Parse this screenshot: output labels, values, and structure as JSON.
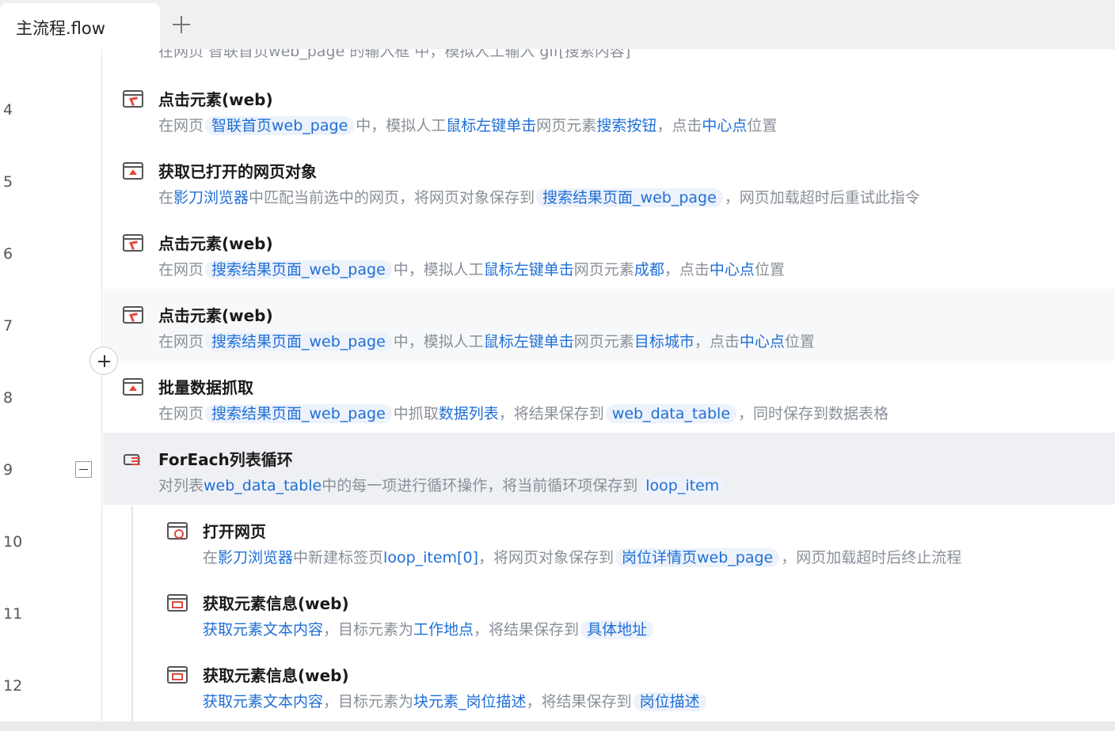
{
  "tabs": [
    {
      "label": "主流程.flow",
      "active": true
    }
  ],
  "line_numbers": [
    "4",
    "5",
    "6",
    "7",
    "8",
    "9",
    "10",
    "11",
    "12"
  ],
  "partial_top_text": "在网页 智联首页web_page 的输入框 中，模拟人工输入 gif[搜索内容]",
  "steps": [
    {
      "title": "点击元素(web)",
      "icon": "click-element-icon",
      "d": {
        "t0": "在网页",
        "c0": "智联首页web_page",
        "t1": "中，模拟人工",
        "h0": "鼠标左键单击",
        "t2": "网页元素",
        "h1": "搜索按钮",
        "t3": "，点击",
        "h2": "中心点",
        "t4": "位置"
      }
    },
    {
      "title": "获取已打开的网页对象",
      "icon": "get-page-icon",
      "d": {
        "t0": "在",
        "h0": "影刀浏览器",
        "t1": "中匹配当前选中的网页，将网页对象保存到",
        "c0": "搜索结果页面_web_page",
        "t2": "，网页加载超时后重试此指令"
      }
    },
    {
      "title": "点击元素(web)",
      "icon": "click-element-icon",
      "d": {
        "t0": "在网页",
        "c0": "搜索结果页面_web_page",
        "t1": "中，模拟人工",
        "h0": "鼠标左键单击",
        "t2": "网页元素",
        "h1": "成都",
        "t3": "，点击",
        "h2": "中心点",
        "t4": "位置"
      }
    },
    {
      "title": "点击元素(web)",
      "icon": "click-element-icon",
      "d": {
        "t0": "在网页",
        "c0": "搜索结果页面_web_page",
        "t1": "中，模拟人工",
        "h0": "鼠标左键单击",
        "t2": "网页元素",
        "h1": "目标城市",
        "t3": "，点击",
        "h2": "中心点",
        "t4": "位置"
      }
    },
    {
      "title": "批量数据抓取",
      "icon": "batch-scrape-icon",
      "d": {
        "t0": "在网页",
        "c0": "搜索结果页面_web_page",
        "t1": "中抓取",
        "h0": "数据列表",
        "t2": "，将结果保存到",
        "c1": "web_data_table",
        "t3": "，同时保存到数据表格"
      }
    },
    {
      "title": "ForEach列表循环",
      "icon": "foreach-loop-icon",
      "d": {
        "t0": "对列表",
        "h0": "web_data_table",
        "t1": "中的每一项进行循环操作，将当前循环项保存到",
        "c0": "loop_item"
      }
    },
    {
      "title": "打开网页",
      "icon": "open-page-icon",
      "d": {
        "t0": "在",
        "h0": "影刀浏览器",
        "t1": "中新建标签页",
        "h1": "loop_item[0]",
        "t2": "，将网页对象保存到",
        "c0": "岗位详情页web_page",
        "t3": "，网页加载超时后终止流程"
      }
    },
    {
      "title": "获取元素信息(web)",
      "icon": "get-element-info-icon",
      "d": {
        "h0": "获取元素文本内容",
        "t0": "，目标元素为",
        "h1": "工作地点",
        "t1": "，将结果保存到",
        "c0": "具体地址"
      }
    },
    {
      "title": "获取元素信息(web)",
      "icon": "get-element-info-icon",
      "d": {
        "h0": "获取元素文本内容",
        "t0": "，目标元素为",
        "h1": "块元素_岗位描述",
        "t1": "，将结果保存到",
        "c0": "岗位描述"
      }
    }
  ]
}
